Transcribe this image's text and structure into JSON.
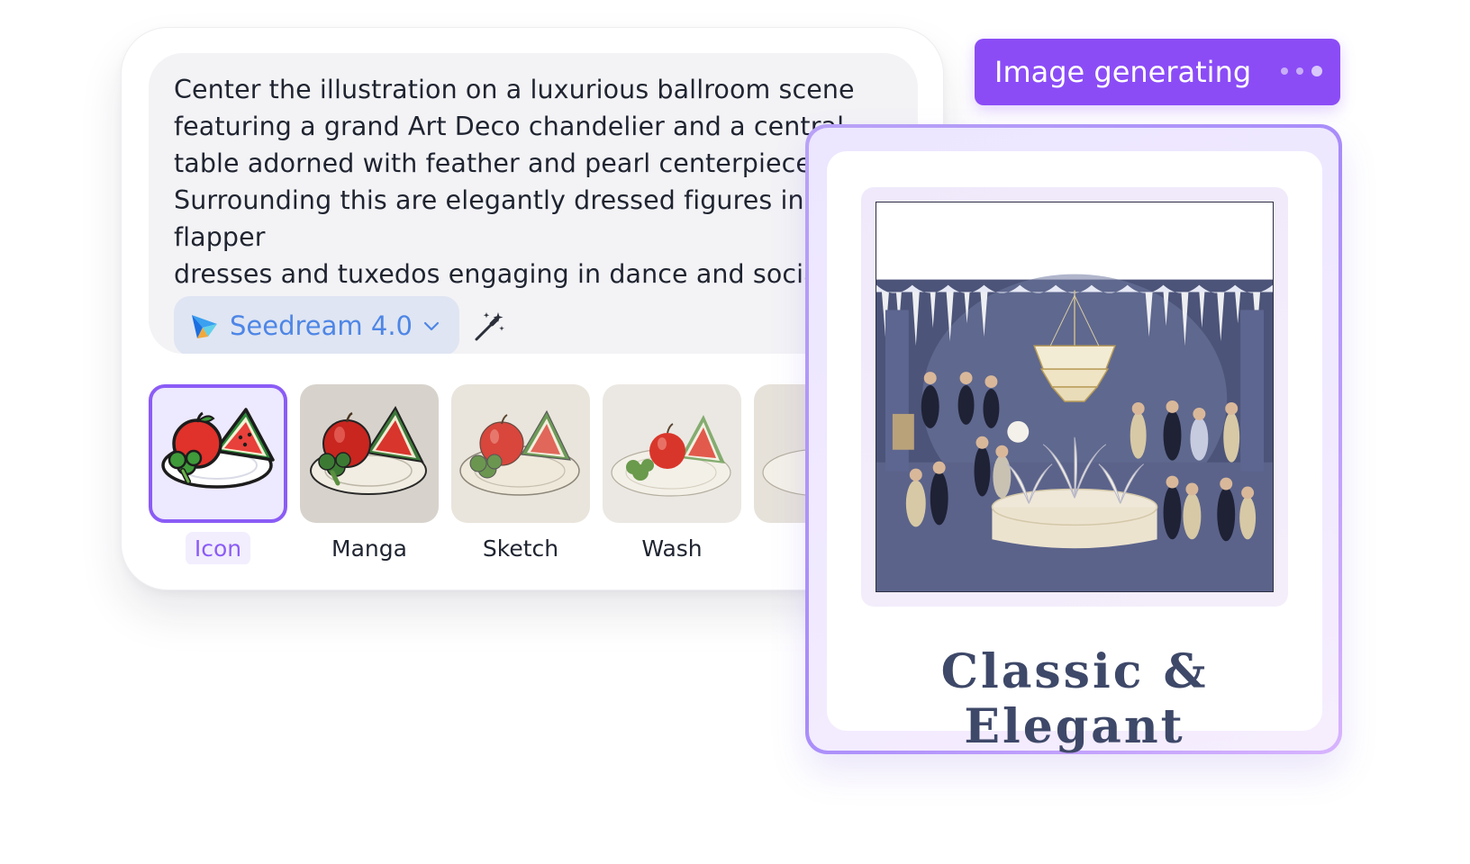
{
  "prompt": {
    "lines": [
      "Center the illustration on a luxurious ballroom scene",
      "featuring a grand Art Deco chandelier and a central",
      "table adorned with feather and pearl centerpieces.",
      "Surrounding this are elegantly dressed figures in flapper",
      "dresses and tuxedos engaging in dance and social"
    ],
    "model_label": "Seedream 4.0",
    "model_icon": "seedream-logo-icon",
    "magic_icon": "magic-wand-icon"
  },
  "styles": [
    {
      "label": "Icon",
      "selected": true
    },
    {
      "label": "Manga",
      "selected": false
    },
    {
      "label": "Sketch",
      "selected": false
    },
    {
      "label": "Wash",
      "selected": false
    }
  ],
  "status": {
    "label": "Image generating"
  },
  "result": {
    "caption": "Classic & Elegant"
  },
  "colors": {
    "accent": "#8b4cf6",
    "model_text": "#4e86e6",
    "caption_text": "#3e4868"
  }
}
